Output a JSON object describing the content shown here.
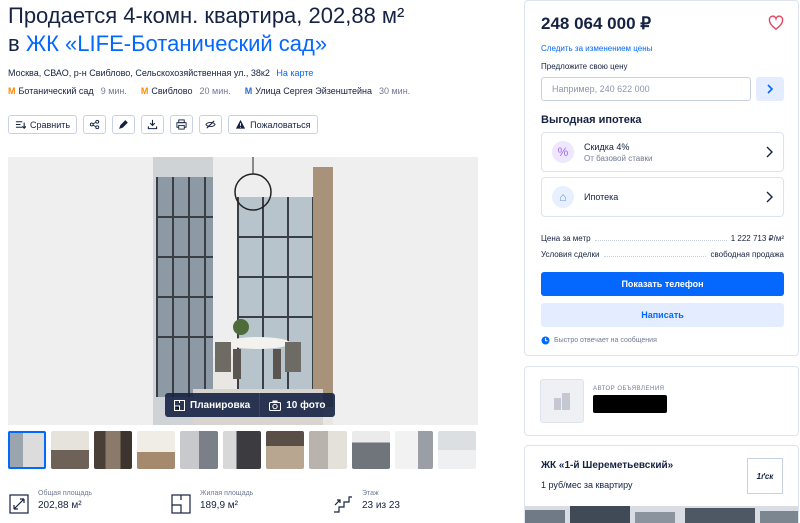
{
  "listing": {
    "title_line1": "Продается 4-комн. квартира, 202,88 м²",
    "title_prefix": "в",
    "complex_link": "ЖК «LIFE-Ботанический сад»",
    "address": "Москва, СВАО, р-н Свиблово, Сельскохозяйственная ул., 38к2",
    "map_link": "На карте",
    "metro": [
      {
        "name": "Ботанический сад",
        "time": "9 мин.",
        "color": "#ff8a00"
      },
      {
        "name": "Свиблово",
        "time": "20 мин.",
        "color": "#ff8a00"
      },
      {
        "name": "Улица Сергея Эйзенштейна",
        "time": "30 мин.",
        "color": "#2b6fd6"
      }
    ]
  },
  "actions": {
    "compare": "Сравнить",
    "complain": "Пожаловаться",
    "icons": [
      "share-icon",
      "edit-icon",
      "download-icon",
      "print-icon",
      "hide-icon"
    ]
  },
  "gallery": {
    "plan_label": "Планировка",
    "photos_label": "10 фото",
    "thumb_count": 11
  },
  "features": [
    {
      "label": "Общая площадь",
      "value": "202,88 м²",
      "icon": "area-icon"
    },
    {
      "label": "Жилая площадь",
      "value": "189,9 м²",
      "icon": "living-area-icon"
    },
    {
      "label": "Этаж",
      "value": "23 из 23",
      "icon": "floor-icon"
    }
  ],
  "sidebar": {
    "price": "248 064 000 ₽",
    "follow_price": "Следить за изменением цены",
    "offer_label": "Предложите свою цену",
    "offer_placeholder": "Например, 240 622 000",
    "mortgage_title": "Выгодная ипотека",
    "discount_title": "Скидка 4%",
    "discount_sub": "От базовой ставки",
    "mortgage_label": "Ипотека",
    "price_per_meter_label": "Цена за метр",
    "price_per_meter_value": "1 222 713 ₽/м²",
    "deal_label": "Условия сделки",
    "deal_value": "свободная продажа",
    "show_phone": "Показать телефон",
    "write": "Написать",
    "fast_reply": "Быстро отвечает на сообщения",
    "accent": "#0468ff"
  },
  "author": {
    "label": "Автор объявления"
  },
  "complex": {
    "name": "ЖК «1-й Шереметьевский»",
    "promo": "1 руб/мес за квартиру",
    "logo_text": "1ґск"
  }
}
